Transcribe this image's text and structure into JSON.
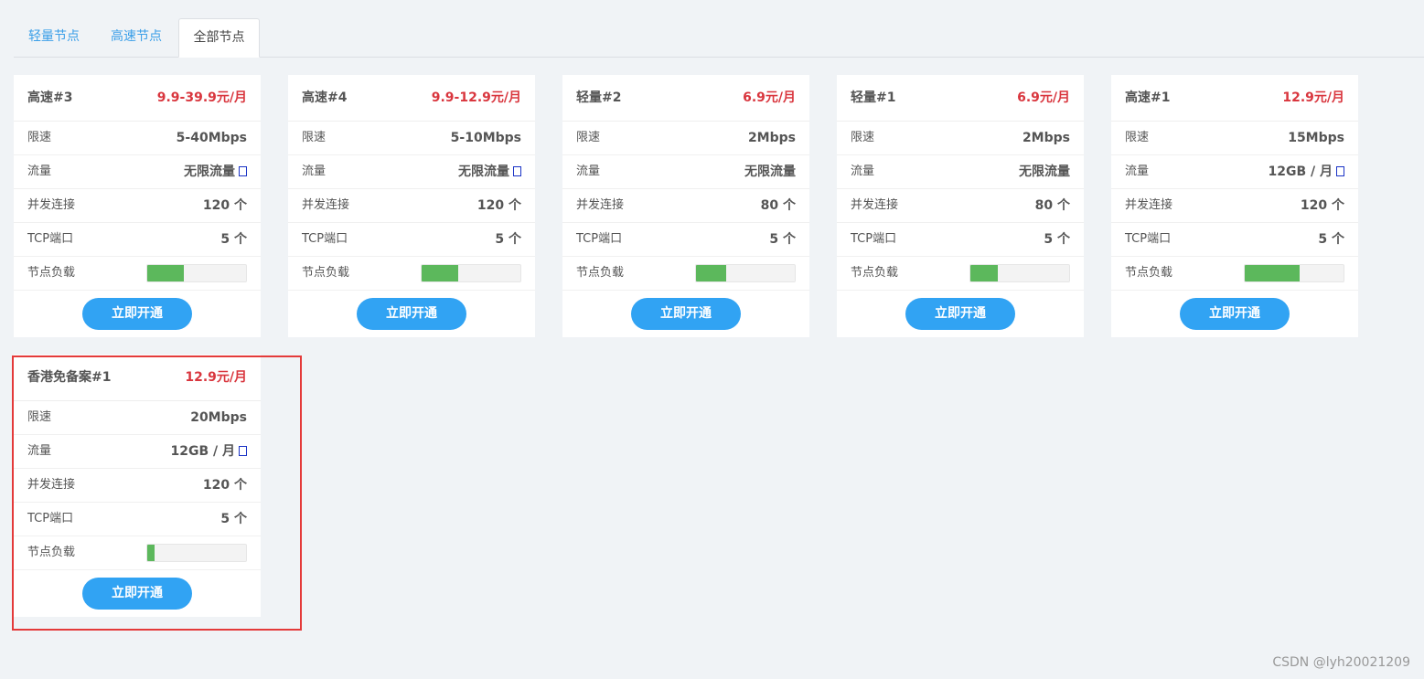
{
  "tabs": [
    {
      "label": "轻量节点",
      "active": false
    },
    {
      "label": "高速节点",
      "active": false
    },
    {
      "label": "全部节点",
      "active": true
    }
  ],
  "labels": {
    "speed": "限速",
    "traffic": "流量",
    "connections": "并发连接",
    "tcp": "TCP端口",
    "load": "节点负载",
    "button": "立即开通"
  },
  "cards": [
    {
      "name": "高速#3",
      "price": "9.9-39.9元/月",
      "speed": "5-40Mbps",
      "traffic": "无限流量",
      "traffic_info": true,
      "connections": "120 个",
      "tcp": "5 个",
      "load": 0.37
    },
    {
      "name": "高速#4",
      "price": "9.9-12.9元/月",
      "speed": "5-10Mbps",
      "traffic": "无限流量",
      "traffic_info": true,
      "connections": "120 个",
      "tcp": "5 个",
      "load": 0.37
    },
    {
      "name": "轻量#2",
      "price": "6.9元/月",
      "speed": "2Mbps",
      "traffic": "无限流量",
      "traffic_info": false,
      "connections": "80 个",
      "tcp": "5 个",
      "load": 0.31
    },
    {
      "name": "轻量#1",
      "price": "6.9元/月",
      "speed": "2Mbps",
      "traffic": "无限流量",
      "traffic_info": false,
      "connections": "80 个",
      "tcp": "5 个",
      "load": 0.28
    },
    {
      "name": "高速#1",
      "price": "12.9元/月",
      "speed": "15Mbps",
      "traffic": "12GB / 月",
      "traffic_info": true,
      "connections": "120 个",
      "tcp": "5 个",
      "load": 0.56
    },
    {
      "name": "香港免备案#1",
      "price": "12.9元/月",
      "speed": "20Mbps",
      "traffic": "12GB / 月",
      "traffic_info": true,
      "connections": "120 个",
      "tcp": "5 个",
      "load": 0.07
    }
  ],
  "colors": {
    "accent": "#31a3f3",
    "price": "#d9363e",
    "load": "#5cb85c",
    "highlight": "#e43a3a"
  },
  "watermark": "CSDN @lyh20021209"
}
